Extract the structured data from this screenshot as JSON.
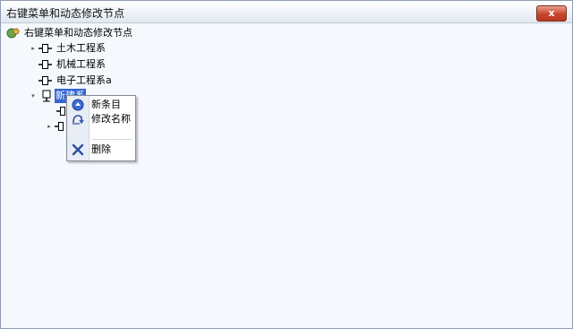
{
  "window": {
    "title": "右键菜单和动态修改节点",
    "close_symbol": "x"
  },
  "tree": {
    "root": {
      "label": "右键菜单和动态修改节点"
    },
    "items": [
      {
        "label": "土木工程系",
        "expander": "▸"
      },
      {
        "label": "机械工程系",
        "expander": ""
      },
      {
        "label": "电子工程系a",
        "expander": ""
      },
      {
        "label": "新建系",
        "expander": "▾",
        "selected": true
      }
    ],
    "children": [
      {
        "label": "",
        "expander": ""
      },
      {
        "label": "",
        "expander": "▸"
      }
    ]
  },
  "context_menu": {
    "items": [
      {
        "label": "新条目",
        "icon": "new-item-icon"
      },
      {
        "label": "修改名称",
        "icon": "rename-icon"
      },
      {
        "label": "删除",
        "icon": "delete-icon"
      }
    ]
  },
  "colors": {
    "selection": "#3465d1",
    "close_button": "#c6452b",
    "client_bg": "#f5f8fd"
  }
}
